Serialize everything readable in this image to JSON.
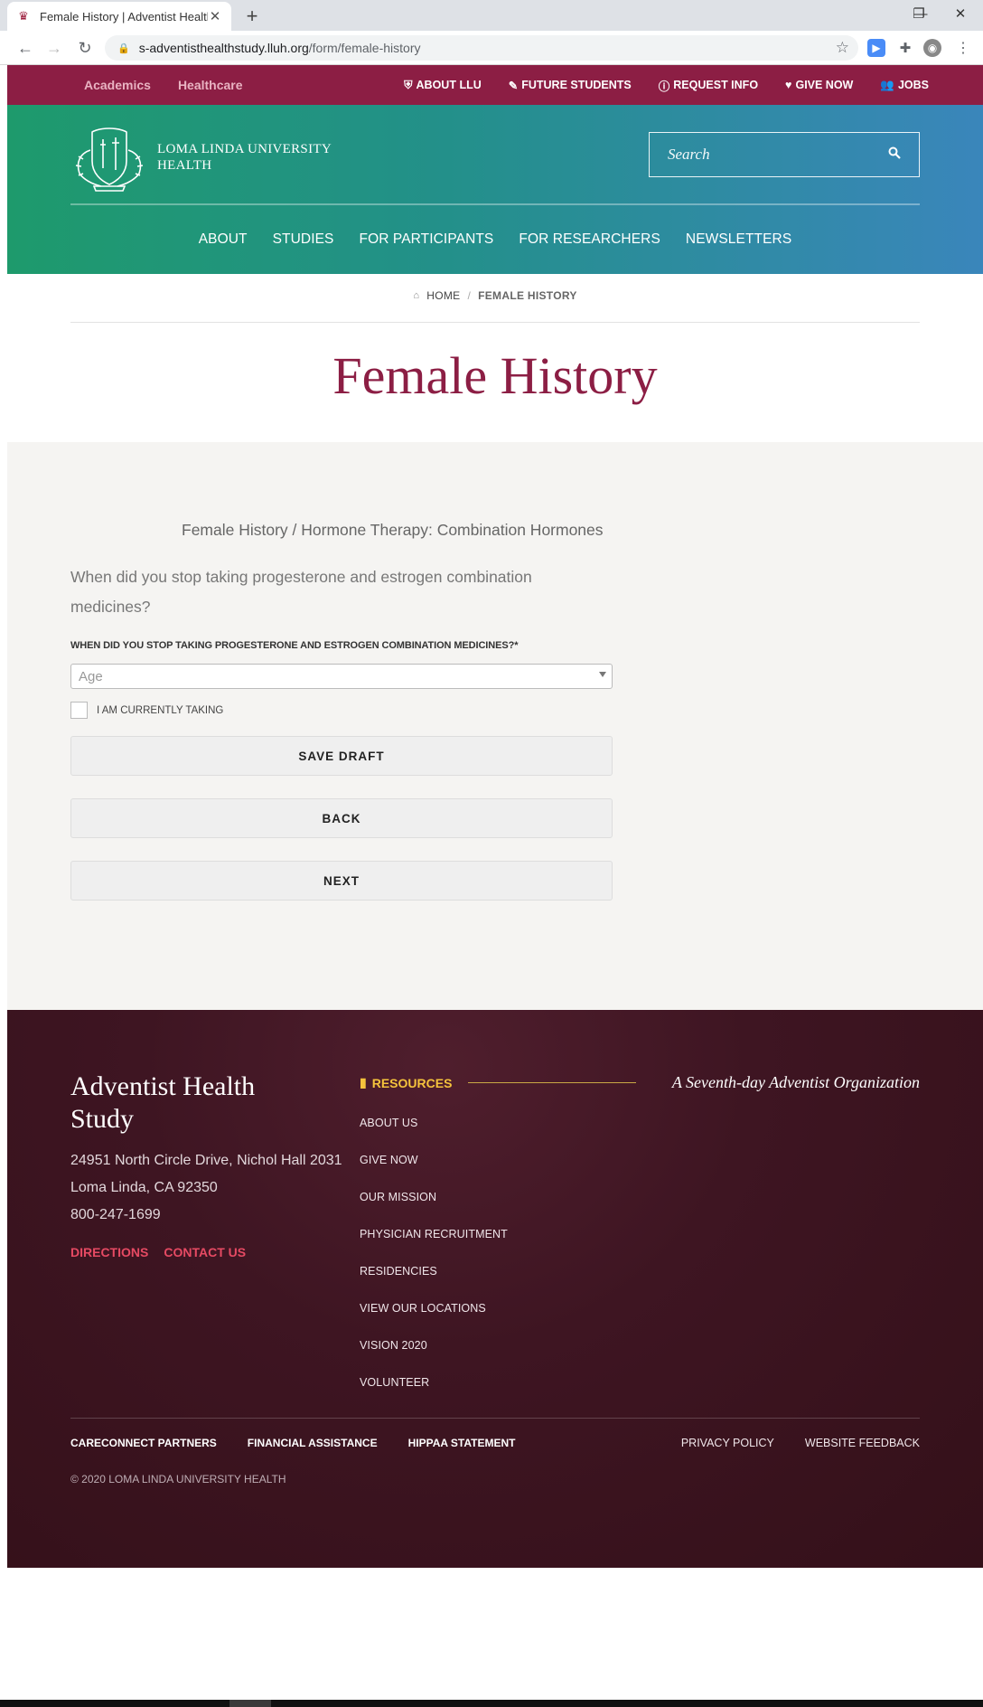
{
  "browser": {
    "tab_title": "Female History | Adventist Health",
    "url_host": "s-adventisthealthstudy.lluh.org",
    "url_path": "/form/female-history"
  },
  "utility_nav": {
    "left": [
      "Academics",
      "Healthcare"
    ],
    "right": [
      "ABOUT LLU",
      "FUTURE STUDENTS",
      "REQUEST INFO",
      "GIVE NOW",
      "JOBS"
    ]
  },
  "header": {
    "logo_line1": "LOMA LINDA UNIVERSITY",
    "logo_line2": "HEALTH",
    "search_placeholder": "Search",
    "nav": [
      "ABOUT",
      "STUDIES",
      "FOR PARTICIPANTS",
      "FOR RESEARCHERS",
      "NEWSLETTERS"
    ]
  },
  "breadcrumb": {
    "home": "HOME",
    "separator": "/",
    "current": "FEMALE HISTORY"
  },
  "page_title": "Female History",
  "form": {
    "section_title": "Female History / Hormone Therapy: Combination Hormones",
    "question": "When did you stop taking progesterone and estrogen combination medicines?",
    "field_label": "WHEN DID YOU STOP TAKING PROGESTERONE AND ESTROGEN COMBINATION MEDICINES?*",
    "select_placeholder": "Age",
    "checkbox_label": "I AM CURRENTLY TAKING",
    "buttons": {
      "save_draft": "SAVE DRAFT",
      "back": "BACK",
      "next": "NEXT"
    }
  },
  "footer": {
    "org_name": "Adventist Health Study",
    "address_line1": "24951 North Circle Drive, Nichol Hall 2031",
    "address_line2": "Loma Linda, CA 92350",
    "phone": "800-247-1699",
    "directions": "DIRECTIONS",
    "contact": "CONTACT US",
    "resources_heading": "RESOURCES",
    "resources": [
      "ABOUT US",
      "GIVE NOW",
      "OUR MISSION",
      "PHYSICIAN RECRUITMENT",
      "RESIDENCIES",
      "VIEW OUR LOCATIONS",
      "VISION 2020",
      "VOLUNTEER"
    ],
    "tagline": "A Seventh-day Adventist Organization",
    "bottom_left": [
      "CARECONNECT PARTNERS",
      "FINANCIAL ASSISTANCE",
      "HIPPAA STATEMENT"
    ],
    "bottom_right": [
      "PRIVACY POLICY",
      "WEBSITE FEEDBACK"
    ],
    "copyright": "© 2020 LOMA LINDA UNIVERSITY HEALTH"
  },
  "colors": {
    "brand_maroon": "#8c1e44",
    "footer_bg": "#3e1522",
    "accent_red": "#e64a63",
    "resources_gold": "#f5c33c",
    "header_gradient_start": "#1e9a6c",
    "header_gradient_end": "#3a86bb"
  },
  "icons": {
    "about_llu": "shield-icon",
    "future_students": "pencil-icon",
    "request_info": "info-icon",
    "give_now": "heart-icon",
    "jobs": "users-icon",
    "search": "search-icon",
    "home": "home-icon",
    "resources": "document-icon"
  }
}
